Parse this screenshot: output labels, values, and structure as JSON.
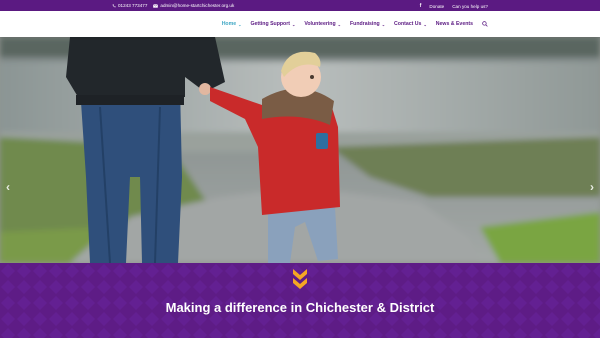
{
  "topbar": {
    "phone": "01243 773477",
    "email": "admin@home-startchichester.org.uk",
    "facebook_icon": "facebook-icon",
    "donate": "Donate",
    "help": "Can you help us?"
  },
  "nav": {
    "items": [
      {
        "label": "Home",
        "dropdown": true,
        "active": true
      },
      {
        "label": "Getting Support",
        "dropdown": true
      },
      {
        "label": "Volunteering",
        "dropdown": true
      },
      {
        "label": "Fundraising",
        "dropdown": true
      },
      {
        "label": "Contact Us",
        "dropdown": true
      },
      {
        "label": "News & Events",
        "dropdown": false
      }
    ],
    "search_icon": "search-icon"
  },
  "hero": {
    "prev_icon": "chevron-left-icon",
    "next_icon": "chevron-right-icon",
    "prev_glyph": "‹",
    "next_glyph": "›"
  },
  "band": {
    "tagline": "Making a difference in Chichester & District",
    "chevron_icon": "double-chevron-down-icon"
  },
  "colors": {
    "brand_purple": "#5b1a82",
    "accent_blue": "#3fa7c4",
    "chevron_orange": "#f5a623"
  }
}
